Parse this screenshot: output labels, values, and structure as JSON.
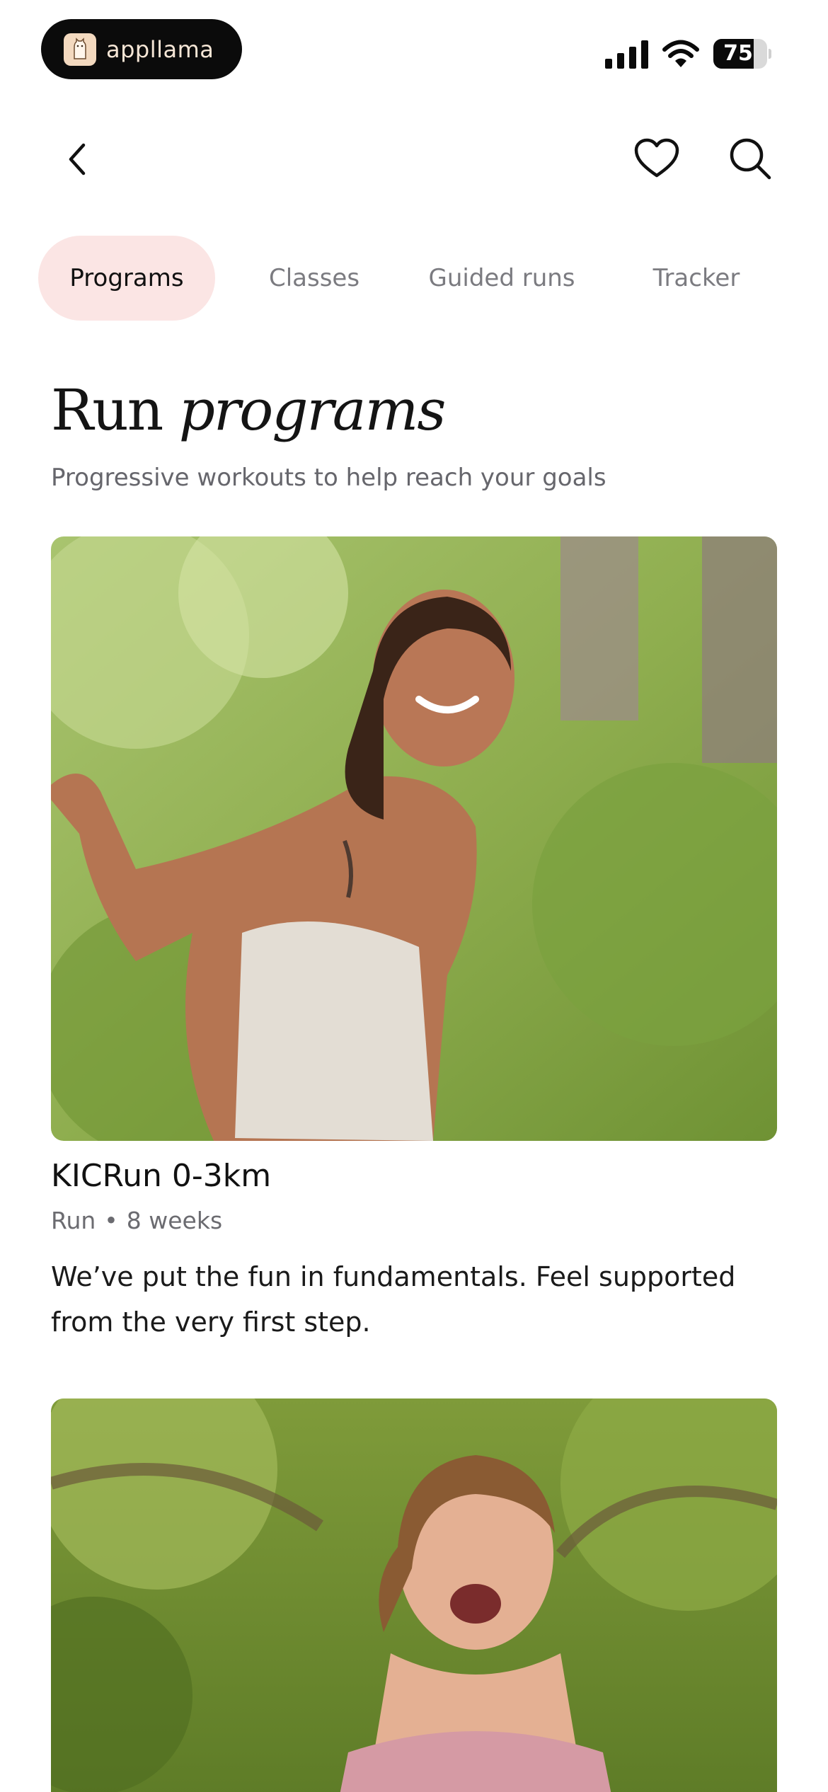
{
  "status_bar": {
    "brand_name": "appllama",
    "battery_level": "75",
    "battery_fraction": 0.75
  },
  "nav": {
    "back_icon": "chevron-left-icon",
    "favorite_icon": "heart-icon",
    "search_icon": "search-icon"
  },
  "tabs": [
    {
      "label": "Programs",
      "active": true
    },
    {
      "label": "Classes",
      "active": false
    },
    {
      "label": "Guided runs",
      "active": false
    },
    {
      "label": "Tracker",
      "active": false
    }
  ],
  "page": {
    "title_regular": "Run",
    "title_italic": "programs",
    "subtitle": "Progressive workouts to help reach your goals"
  },
  "programs": [
    {
      "title": "KICRun 0-3km",
      "category": "Run",
      "duration": "8 weeks",
      "description": "We’ve put the fun in fundamentals. Feel supported from the very first step."
    }
  ],
  "colors": {
    "active_tab_bg": "#fbe5e4",
    "brand_pill_bg": "#0b0b0b"
  }
}
